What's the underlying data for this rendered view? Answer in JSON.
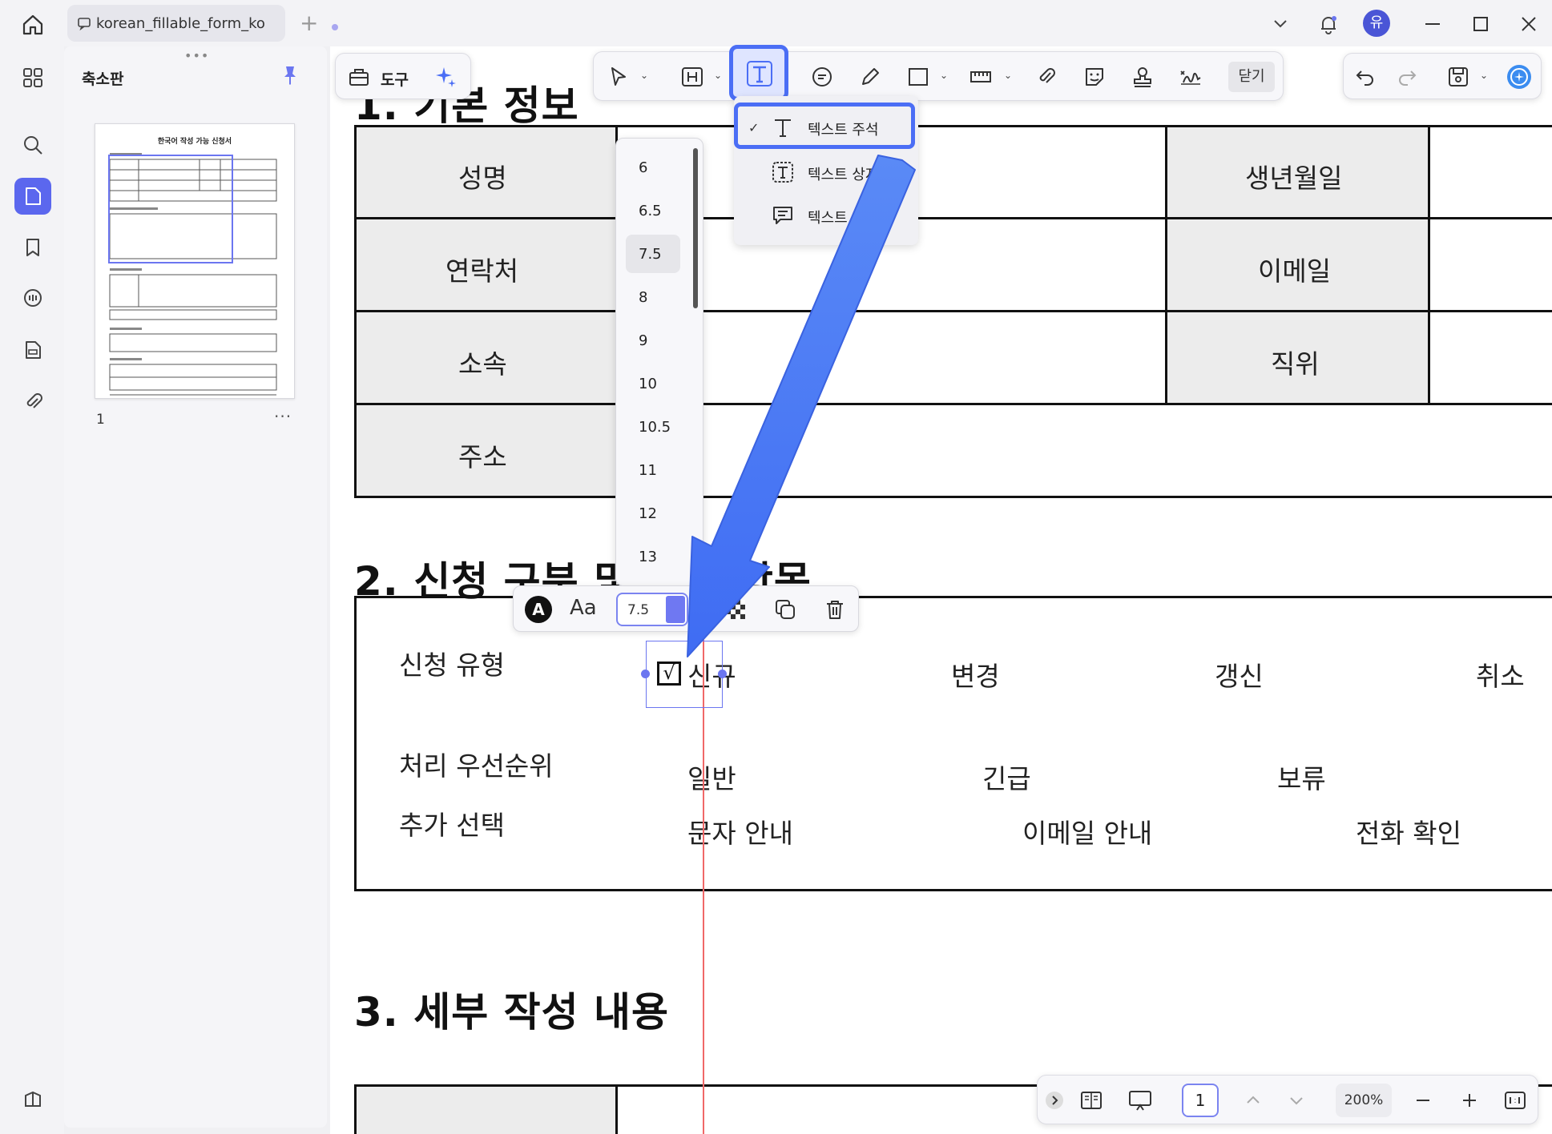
{
  "window": {
    "tab_title": "korean_fillable_form_ko",
    "avatar_letter": "유"
  },
  "panel": {
    "title": "축소판",
    "page_number": "1",
    "more": "···",
    "thumb_title": "한국어 작성 가능 신청서"
  },
  "toolbar": {
    "tools_label": "도구",
    "close_label": "닫기"
  },
  "text_menu": {
    "items": [
      {
        "label": "텍스트 주석",
        "checked": true
      },
      {
        "label": "텍스트 상자",
        "checked": false
      },
      {
        "label": "텍스트 메모",
        "checked": false
      }
    ]
  },
  "font_sizes": {
    "items": [
      "6",
      "6.5",
      "7.5",
      "8",
      "9",
      "10",
      "10.5",
      "11",
      "12",
      "13"
    ],
    "selected": "7.5"
  },
  "prop_bar": {
    "font_letter": "A",
    "aa": "Aa",
    "size_value": "7.5"
  },
  "doc": {
    "sec1_title": "1. 기본 정보",
    "sec2_title": "2. 신청 구분 및 선택 항목",
    "sec3_title": "3. 세부 작성 내용",
    "sec1_labels": [
      "성명",
      "연락처",
      "소속",
      "주소"
    ],
    "sec1_right_labels": [
      "생년월일",
      "이메일",
      "직위"
    ],
    "row_type_label": "신청 유형",
    "row_type_options": [
      "신규",
      "변경",
      "갱신",
      "취소"
    ],
    "row_priority_label": "처리 우선순위",
    "row_priority_options": [
      "일반",
      "긴급",
      "보류"
    ],
    "row_extra_label": "추가 선택",
    "row_extra_options": [
      "문자 안내",
      "이메일 안내",
      "전화 확인"
    ],
    "checkbox_mark": "√"
  },
  "bottom_bar": {
    "page_value": "1",
    "zoom": "200%"
  },
  "colors": {
    "accent": "#4b6ef5",
    "selection": "#6b76f0",
    "guide": "#f06868"
  }
}
